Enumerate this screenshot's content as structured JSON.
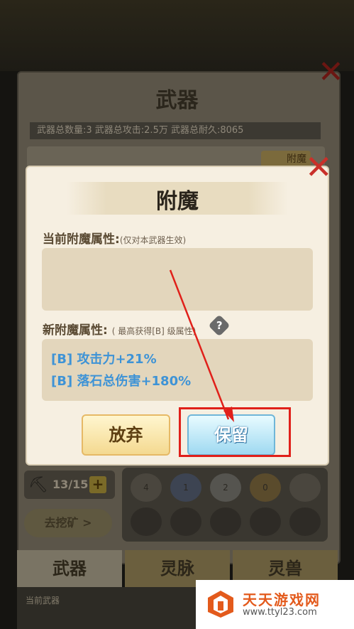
{
  "background": {
    "title": "武器",
    "stats": "武器总数量:3  武器总攻击:2.5万  武器总耐久:8065",
    "row_badge": "附魔",
    "pick_counter": "13/15",
    "plus": "+",
    "go_mine": "去挖矿 >",
    "ores": [
      "4",
      "1",
      "2",
      "0"
    ],
    "tabs": [
      "武器",
      "灵脉",
      "灵兽"
    ],
    "bottom_text": "当前武器"
  },
  "dialog": {
    "title": "附魔",
    "current_label": "当前附魔属性:",
    "current_note": "(仅对本武器生效)",
    "new_label": "新附魔属性:",
    "new_note": "( 最高获得[B] 级属性)",
    "help": "?",
    "new_attrs": [
      "[B] 攻击力+21%",
      "[B] 落石总伤害+180%"
    ],
    "abandon": "放弃",
    "keep": "保留"
  },
  "watermark": {
    "name": "天天游戏网",
    "url": "www.ttyl23.com"
  },
  "colors": {
    "attr_blue": "#3e93d6",
    "highlight_red": "#e0201a",
    "close_red": "#c9302a"
  },
  "icons": [
    "close-icon",
    "help-icon",
    "pickaxe-icon",
    "plus-icon",
    "ore-icon",
    "logo-icon",
    "arrow-annotation"
  ]
}
